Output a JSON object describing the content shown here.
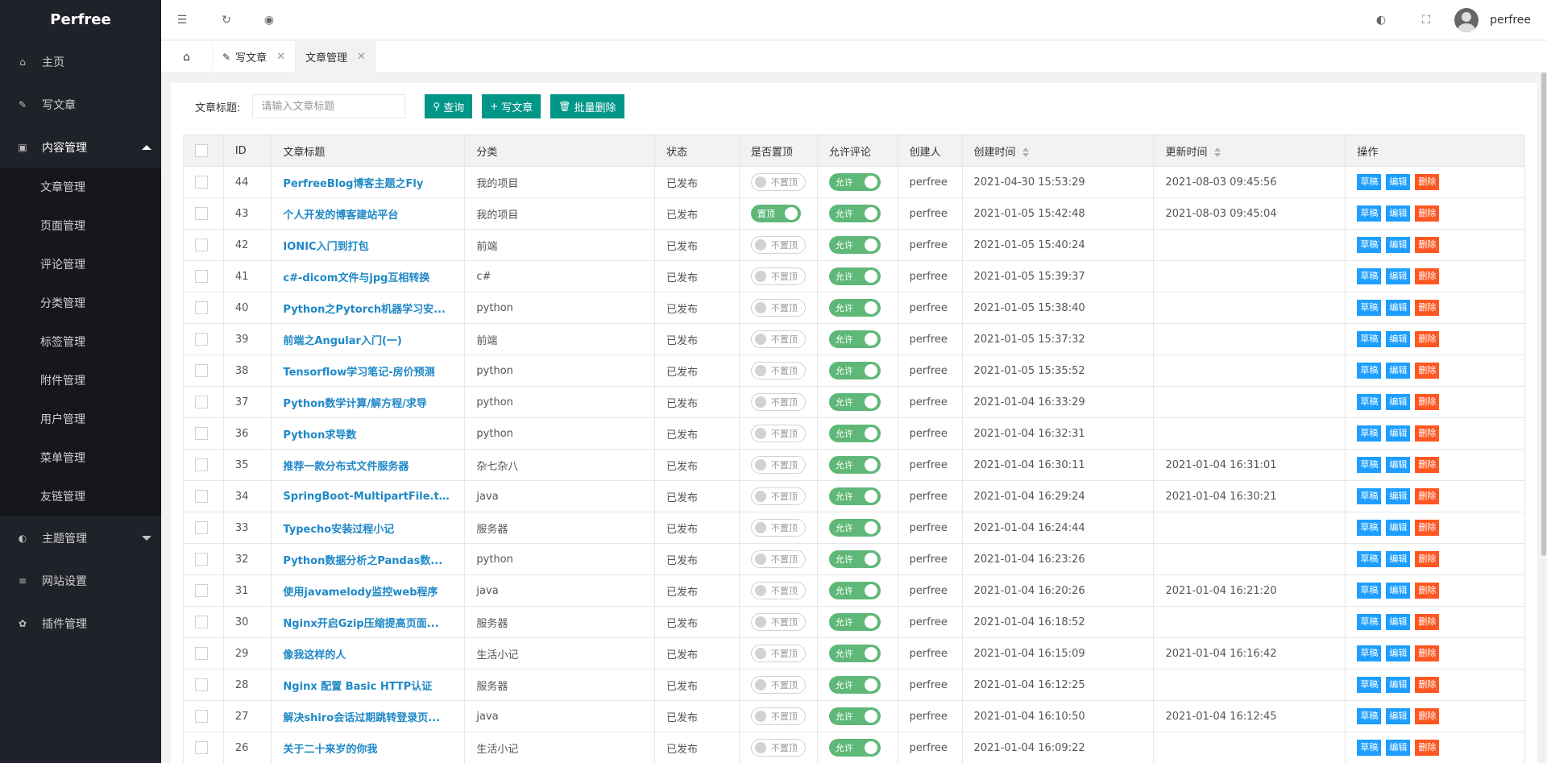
{
  "app": {
    "logo": "Perfree"
  },
  "sidebar": {
    "items": [
      {
        "label": "主页",
        "icon": "home-icon"
      },
      {
        "label": "写文章",
        "icon": "edit-icon"
      },
      {
        "label": "内容管理",
        "icon": "inbox-icon",
        "open": true
      },
      {
        "label": "主题管理",
        "icon": "palette-icon"
      },
      {
        "label": "网站设置",
        "icon": "sliders-icon"
      },
      {
        "label": "插件管理",
        "icon": "leaf-icon"
      }
    ],
    "submenu": [
      "文章管理",
      "页面管理",
      "评论管理",
      "分类管理",
      "标签管理",
      "附件管理",
      "用户管理",
      "菜单管理",
      "友链管理"
    ]
  },
  "header": {
    "username": "perfree"
  },
  "tabs": [
    {
      "label": "写文章"
    },
    {
      "label": "文章管理"
    }
  ],
  "toolbar": {
    "title_label": "文章标题:",
    "search_placeholder": "请输入文章标题",
    "search_button": "查询",
    "write_button": "写文章",
    "batch_delete_button": "批量删除"
  },
  "table": {
    "headers": [
      "ID",
      "文章标题",
      "分类",
      "状态",
      "是否置顶",
      "允许评论",
      "创建人",
      "创建时间",
      "更新时间",
      "操作"
    ],
    "top_on_label": "置顶",
    "top_off_label": "不置顶",
    "comment_on_label": "允许",
    "op_draft": "草稿",
    "op_edit": "编辑",
    "op_delete": "删除",
    "rows": [
      {
        "id": "44",
        "title": "PerfreeBlog博客主题之Fly",
        "category": "我的项目",
        "status": "已发布",
        "top": false,
        "author": "perfree",
        "created": "2021-04-30 15:53:29",
        "updated": "2021-08-03 09:45:56"
      },
      {
        "id": "43",
        "title": "个人开发的博客建站平台",
        "category": "我的项目",
        "status": "已发布",
        "top": true,
        "author": "perfree",
        "created": "2021-01-05 15:42:48",
        "updated": "2021-08-03 09:45:04"
      },
      {
        "id": "42",
        "title": "IONIC入门到打包",
        "category": "前端",
        "status": "已发布",
        "top": false,
        "author": "perfree",
        "created": "2021-01-05 15:40:24",
        "updated": ""
      },
      {
        "id": "41",
        "title": "c#-dicom文件与jpg互相转换",
        "category": "c#",
        "status": "已发布",
        "top": false,
        "author": "perfree",
        "created": "2021-01-05 15:39:37",
        "updated": ""
      },
      {
        "id": "40",
        "title": "Python之Pytorch机器学习安...",
        "category": "python",
        "status": "已发布",
        "top": false,
        "author": "perfree",
        "created": "2021-01-05 15:38:40",
        "updated": ""
      },
      {
        "id": "39",
        "title": "前端之Angular入门(一)",
        "category": "前端",
        "status": "已发布",
        "top": false,
        "author": "perfree",
        "created": "2021-01-05 15:37:32",
        "updated": ""
      },
      {
        "id": "38",
        "title": "Tensorflow学习笔记-房价预测",
        "category": "python",
        "status": "已发布",
        "top": false,
        "author": "perfree",
        "created": "2021-01-05 15:35:52",
        "updated": ""
      },
      {
        "id": "37",
        "title": "Python数学计算/解方程/求导",
        "category": "python",
        "status": "已发布",
        "top": false,
        "author": "perfree",
        "created": "2021-01-04 16:33:29",
        "updated": ""
      },
      {
        "id": "36",
        "title": "Python求导数",
        "category": "python",
        "status": "已发布",
        "top": false,
        "author": "perfree",
        "created": "2021-01-04 16:32:31",
        "updated": ""
      },
      {
        "id": "35",
        "title": "推荐一款分布式文件服务器",
        "category": "杂七杂八",
        "status": "已发布",
        "top": false,
        "author": "perfree",
        "created": "2021-01-04 16:30:11",
        "updated": "2021-01-04 16:31:01"
      },
      {
        "id": "34",
        "title": "SpringBoot-MultipartFile.tran...",
        "category": "java",
        "status": "已发布",
        "top": false,
        "author": "perfree",
        "created": "2021-01-04 16:29:24",
        "updated": "2021-01-04 16:30:21"
      },
      {
        "id": "33",
        "title": "Typecho安装过程小记",
        "category": "服务器",
        "status": "已发布",
        "top": false,
        "author": "perfree",
        "created": "2021-01-04 16:24:44",
        "updated": ""
      },
      {
        "id": "32",
        "title": "Python数据分析之Pandas数...",
        "category": "python",
        "status": "已发布",
        "top": false,
        "author": "perfree",
        "created": "2021-01-04 16:23:26",
        "updated": ""
      },
      {
        "id": "31",
        "title": "使用javamelody监控web程序",
        "category": "java",
        "status": "已发布",
        "top": false,
        "author": "perfree",
        "created": "2021-01-04 16:20:26",
        "updated": "2021-01-04 16:21:20"
      },
      {
        "id": "30",
        "title": "Nginx开启Gzip压缩提高页面...",
        "category": "服务器",
        "status": "已发布",
        "top": false,
        "author": "perfree",
        "created": "2021-01-04 16:18:52",
        "updated": ""
      },
      {
        "id": "29",
        "title": "像我这样的人",
        "category": "生活小记",
        "status": "已发布",
        "top": false,
        "author": "perfree",
        "created": "2021-01-04 16:15:09",
        "updated": "2021-01-04 16:16:42"
      },
      {
        "id": "28",
        "title": "Nginx 配置 Basic HTTP认证",
        "category": "服务器",
        "status": "已发布",
        "top": false,
        "author": "perfree",
        "created": "2021-01-04 16:12:25",
        "updated": ""
      },
      {
        "id": "27",
        "title": "解决shiro会话过期跳转登录页...",
        "category": "java",
        "status": "已发布",
        "top": false,
        "author": "perfree",
        "created": "2021-01-04 16:10:50",
        "updated": "2021-01-04 16:12:45"
      },
      {
        "id": "26",
        "title": "关于二十来岁的你我",
        "category": "生活小记",
        "status": "已发布",
        "top": false,
        "author": "perfree",
        "created": "2021-01-04 16:09:22",
        "updated": ""
      }
    ]
  }
}
